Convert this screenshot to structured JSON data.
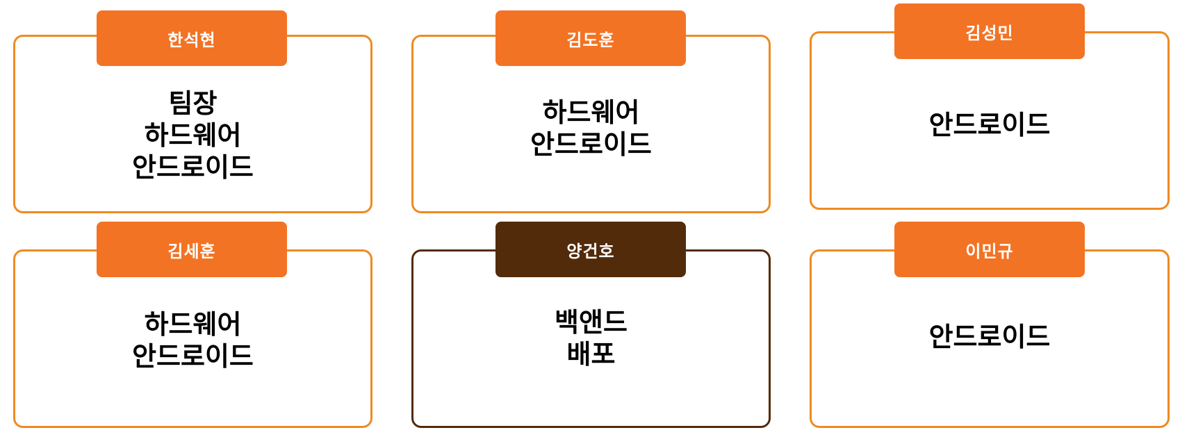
{
  "colors": {
    "accent_orange": "#F37324",
    "border_orange": "#EE8A22",
    "accent_brown": "#522B0B",
    "text": "#000000",
    "tag_text": "#FFFFFF"
  },
  "members": [
    {
      "name": "한석현",
      "roles": [
        "팀장",
        "하드웨어",
        "안드로이드"
      ]
    },
    {
      "name": "김도훈",
      "roles": [
        "하드웨어",
        "안드로이드"
      ]
    },
    {
      "name": "김성민",
      "roles": [
        "안드로이드"
      ]
    },
    {
      "name": "김세훈",
      "roles": [
        "하드웨어",
        "안드로이드"
      ]
    },
    {
      "name": "양건호",
      "roles": [
        "백앤드",
        "배포"
      ]
    },
    {
      "name": "이민규",
      "roles": [
        "안드로이드"
      ]
    }
  ]
}
